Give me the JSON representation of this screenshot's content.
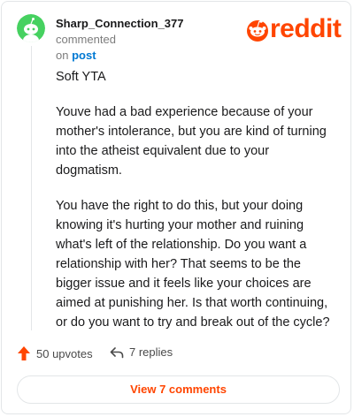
{
  "comment": {
    "username": "Sharp_Connection_377",
    "action_text": " commented",
    "on_text": "on ",
    "post_link": "post",
    "paragraphs": [
      "Soft YTA",
      "Youve had a bad experience because of your mother's intolerance, but you are kind of turning into the atheist equivalent due to your dogmatism.",
      "You have the right to do this, but your doing knowing it's hurting your mother and ruining what's left of the relationship. Do you want a relationship with her? That seems to be the bigger issue and it feels like your choices are aimed at punishing her. Is that worth continuing, or do you want to try and break out of the cycle?"
    ]
  },
  "brand": {
    "name": "reddit",
    "color": "#ff4500"
  },
  "stats": {
    "upvotes": "50 upvotes",
    "replies": "7 replies"
  },
  "footer": {
    "view_comments_label": "View 7 comments"
  },
  "colors": {
    "avatar_bg": "#46d160",
    "upvote": "#ff4500",
    "link": "#0079d3"
  }
}
